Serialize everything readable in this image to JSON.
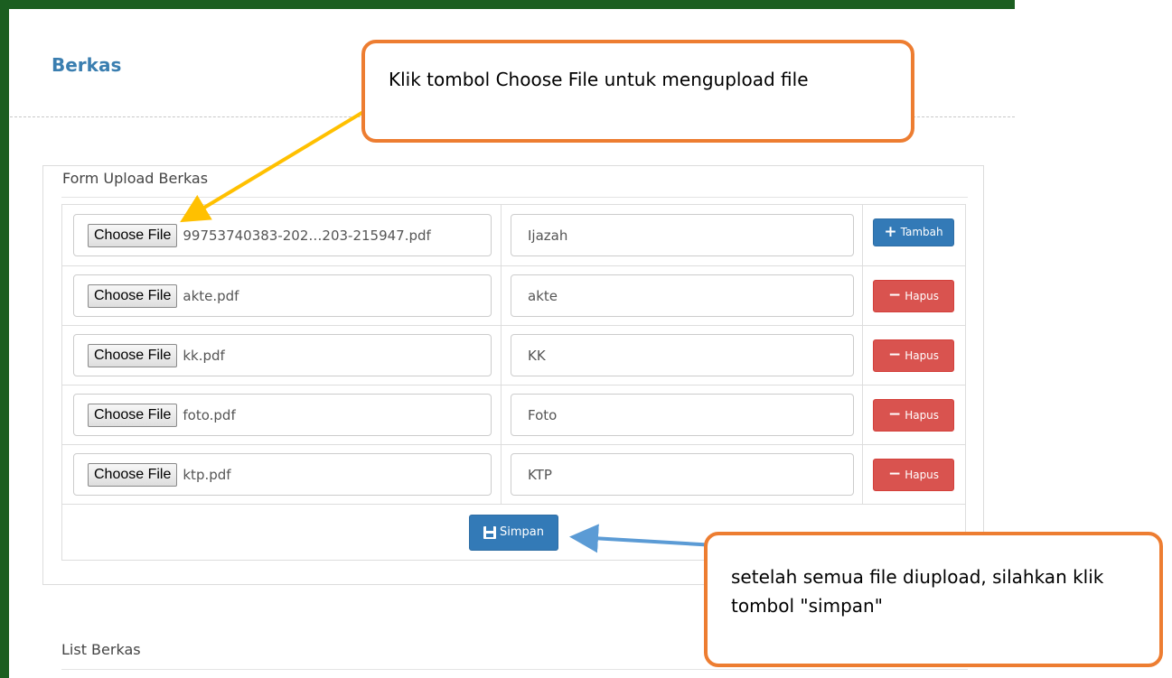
{
  "page": {
    "title": "Berkas",
    "accent_color": "#1b5e20"
  },
  "form": {
    "title": "Form Upload Berkas",
    "choose_file_label": "Choose File",
    "rows": [
      {
        "file_name": "99753740383-202…203-215947.pdf",
        "label": "Ijazah",
        "action": "Tambah"
      },
      {
        "file_name": "akte.pdf",
        "label": "akte",
        "action": "Hapus"
      },
      {
        "file_name": "kk.pdf",
        "label": "KK",
        "action": "Hapus"
      },
      {
        "file_name": "foto.pdf",
        "label": "Foto",
        "action": "Hapus"
      },
      {
        "file_name": "ktp.pdf",
        "label": "KTP",
        "action": "Hapus"
      }
    ],
    "save_label": "Simpan",
    "colors": {
      "add": "#337ab7",
      "delete": "#d9534f",
      "save": "#337ab7"
    }
  },
  "list": {
    "title": "List Berkas"
  },
  "annotations": {
    "top_callout": "Klik tombol Choose File untuk mengupload file",
    "bottom_callout": "setelah semua file diupload, silahkan klik tombol \"simpan\"",
    "callout_color": "#ed7d31",
    "arrow_top_color": "#ffc000",
    "arrow_bottom_color": "#5b9bd5"
  }
}
